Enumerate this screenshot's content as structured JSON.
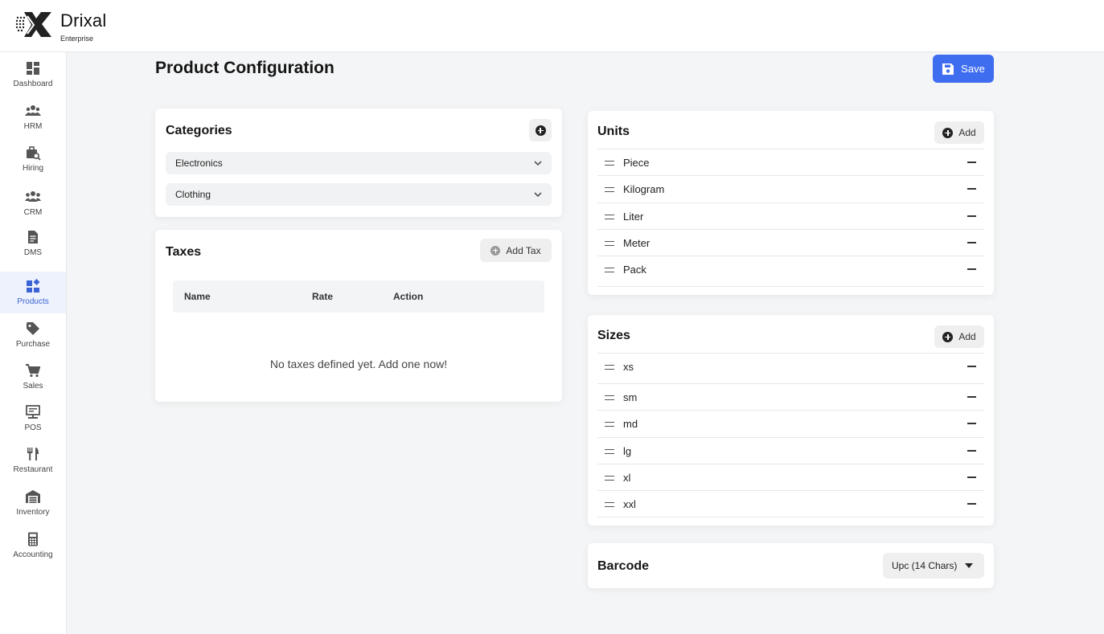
{
  "brand": {
    "name": "Drixal",
    "subtitle": "Enterprise"
  },
  "sidebar": {
    "items": [
      {
        "label": "Dashboard",
        "icon": "dashboard-icon",
        "active": false
      },
      {
        "label": "HRM",
        "icon": "people-icon",
        "active": false
      },
      {
        "label": "Hiring",
        "icon": "briefcase-search-icon",
        "active": false
      },
      {
        "label": "CRM",
        "icon": "group-icon",
        "active": false
      },
      {
        "label": "DMS",
        "icon": "document-icon",
        "active": false
      },
      {
        "label": "Products",
        "icon": "widgets-icon",
        "active": true
      },
      {
        "label": "Purchase",
        "icon": "tag-icon",
        "active": false
      },
      {
        "label": "Sales",
        "icon": "cart-icon",
        "active": false
      },
      {
        "label": "POS",
        "icon": "pos-terminal-icon",
        "active": false
      },
      {
        "label": "Restaurant",
        "icon": "fork-knife-icon",
        "active": false
      },
      {
        "label": "Inventory",
        "icon": "warehouse-icon",
        "active": false
      },
      {
        "label": "Accounting",
        "icon": "calculator-icon",
        "active": false
      }
    ]
  },
  "page": {
    "title": "Product Configuration",
    "save_label": "Save"
  },
  "categories": {
    "title": "Categories",
    "items": [
      "Electronics",
      "Clothing"
    ]
  },
  "taxes": {
    "title": "Taxes",
    "add_label": "Add Tax",
    "columns": [
      "Name",
      "Rate",
      "Action"
    ],
    "empty_message": "No taxes defined yet. Add one now!"
  },
  "units": {
    "title": "Units",
    "add_label": "Add",
    "items": [
      "Piece",
      "Kilogram",
      "Liter",
      "Meter",
      "Pack"
    ]
  },
  "sizes": {
    "title": "Sizes",
    "add_label": "Add",
    "items": [
      "xs",
      "sm",
      "md",
      "lg",
      "xl",
      "xxl"
    ]
  },
  "barcode": {
    "title": "Barcode",
    "selected": "Upc (14 Chars)"
  },
  "colors": {
    "accent": "#3f6df0",
    "active_nav": "#3b63d6"
  }
}
